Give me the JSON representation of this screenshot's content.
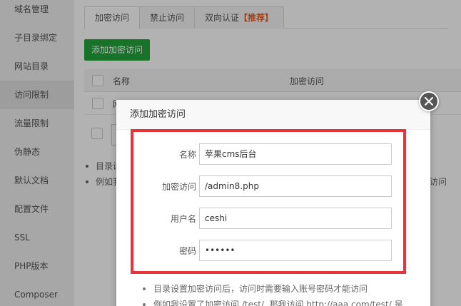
{
  "sidebar": {
    "items": [
      {
        "label": "域名管理"
      },
      {
        "label": "子目录绑定"
      },
      {
        "label": "网站目录"
      },
      {
        "label": "访问限制"
      },
      {
        "label": "流量限制"
      },
      {
        "label": "伪静态"
      },
      {
        "label": "默认文档"
      },
      {
        "label": "配置文件"
      },
      {
        "label": "SSL"
      },
      {
        "label": "PHP版本"
      },
      {
        "label": "Composer"
      }
    ],
    "active_index": 3
  },
  "tabs": {
    "items": [
      {
        "label": "加密访问"
      },
      {
        "label": "禁止访问"
      },
      {
        "label": "双向认证",
        "badge": "【推荐】"
      }
    ],
    "active_index": 0
  },
  "add_button": {
    "label": "添加加密访问"
  },
  "table": {
    "columns": [
      "名称",
      "加密访问"
    ],
    "rows": [
      {
        "name_fragment": "网"
      }
    ]
  },
  "background_notes": {
    "items": [
      "目录设",
      "例如我"
    ],
    "tail": "访问"
  },
  "dialog": {
    "title": "添加加密访问",
    "fields": [
      {
        "label": "名称",
        "value": "苹果cms后台"
      },
      {
        "label": "加密访问",
        "value": "/admin8.php"
      },
      {
        "label": "用户名",
        "value": "ceshi"
      },
      {
        "label": "密码",
        "value": "••••••"
      }
    ],
    "notes": [
      "目录设置加密访问后，访问时需要输入账号密码才能访问",
      "例如我设置了加密访问 /test/ ,那我访问 http://aaa.com/test/ 是"
    ]
  },
  "colors": {
    "accent_green": "#20a53a",
    "highlight_red": "#e8333a",
    "badge_orange": "#e75e24"
  }
}
